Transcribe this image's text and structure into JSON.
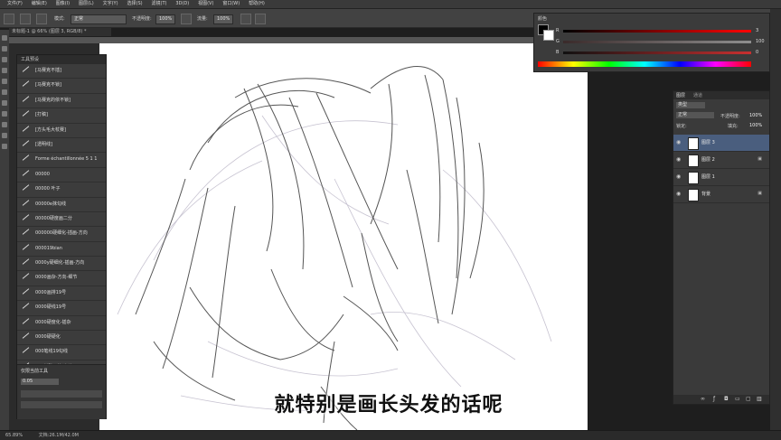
{
  "menu": [
    "文件(F)",
    "编辑(E)",
    "图像(I)",
    "图层(L)",
    "文字(Y)",
    "选择(S)",
    "滤镜(T)",
    "3D(D)",
    "视图(V)",
    "窗口(W)",
    "帮助(H)"
  ],
  "options": {
    "mode_label": "模式:",
    "mode_value": "正常",
    "opacity_label": "不透明度:",
    "opacity_value": "100%",
    "flow_label": "流量:",
    "flow_value": "100%"
  },
  "document": {
    "tab": "未标题-1 @ 66% (图层 3, RGB/8) *"
  },
  "brush_panel": {
    "title": "工具预设",
    "items": [
      "[马赛克不插]",
      "[马赛克不锁]",
      "[马赛克的依不锁]",
      "[打稿]",
      "[方头毛大杖赛]",
      "[透明线]",
      "Forme échantillonnée 5 1 1",
      "00000",
      "00000 叶子",
      "00000e抹勾线",
      "00000硬度画二分",
      "000000硬细化-插画-方向",
      "000019bian",
      "0000y硬细化-插画-方向",
      "0000画杂-方向-细节",
      "0000画排19号",
      "0000硬线19号",
      "0000硬度化-插杂",
      "0000硬硬化",
      "000笔线19勾线",
      "000基础画笔-方头0"
    ],
    "footer_label": "仅限当前工具",
    "footer_field": "0.05"
  },
  "color_panel": {
    "title": "颜色",
    "r_label": "R",
    "g_label": "G",
    "b_label": "B",
    "r_value": "3",
    "g_value": "100",
    "b_value": "0"
  },
  "layers_panel": {
    "tabs": [
      "图层",
      "通道"
    ],
    "kind": "类型",
    "blend": "正常",
    "opacity_label": "不透明度:",
    "opacity_value": "100%",
    "lock_label": "锁定:",
    "fill_label": "填充:",
    "fill_value": "100%",
    "layers": [
      {
        "name": "图层 3",
        "selected": true
      },
      {
        "name": "图层 2",
        "selected": false
      },
      {
        "name": "图层 1",
        "selected": false
      },
      {
        "name": "背景",
        "selected": false
      }
    ]
  },
  "status": {
    "zoom": "65.89%",
    "doc": "文档:26.1M/42.0M"
  },
  "subtitle": "就特别是画长头发的话呢",
  "colors": {
    "accent": "#4a5e7e",
    "canvas": "#ffffff"
  }
}
